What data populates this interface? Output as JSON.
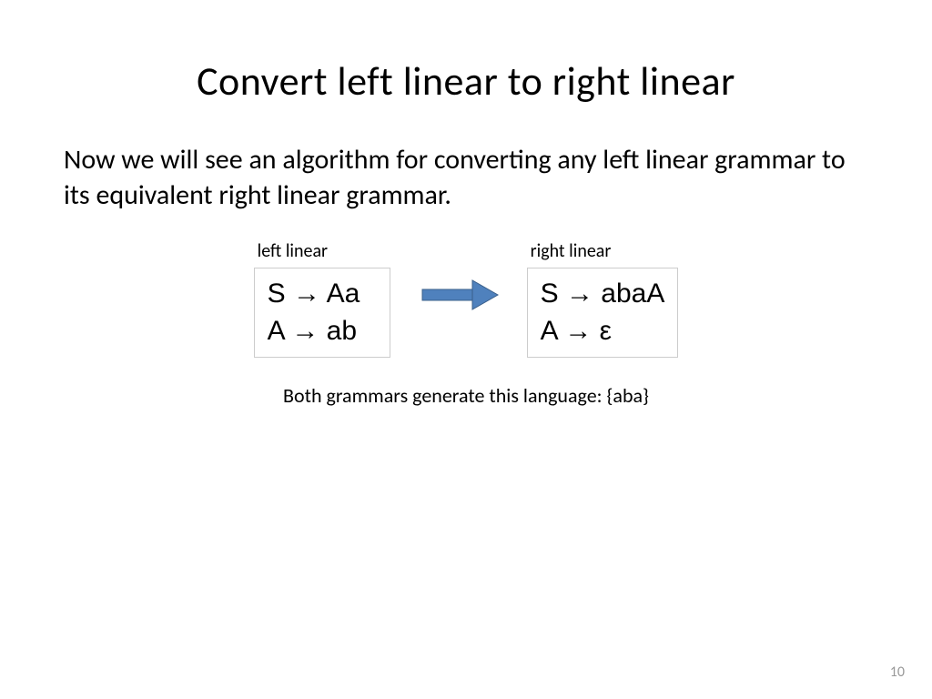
{
  "title": "Convert left linear to right linear",
  "body": "Now we will see an algorithm for converting any left linear grammar to its equivalent right linear grammar.",
  "left_grammar": {
    "label": "left linear",
    "rule1": "S → Aa",
    "rule2": "A → ab"
  },
  "right_grammar": {
    "label": "right linear",
    "rule1": "S → abaA",
    "rule2": "A → ε"
  },
  "caption": "Both grammars generate this language: {aba}",
  "page_number": "10",
  "arrow_color": "#4f81bd"
}
